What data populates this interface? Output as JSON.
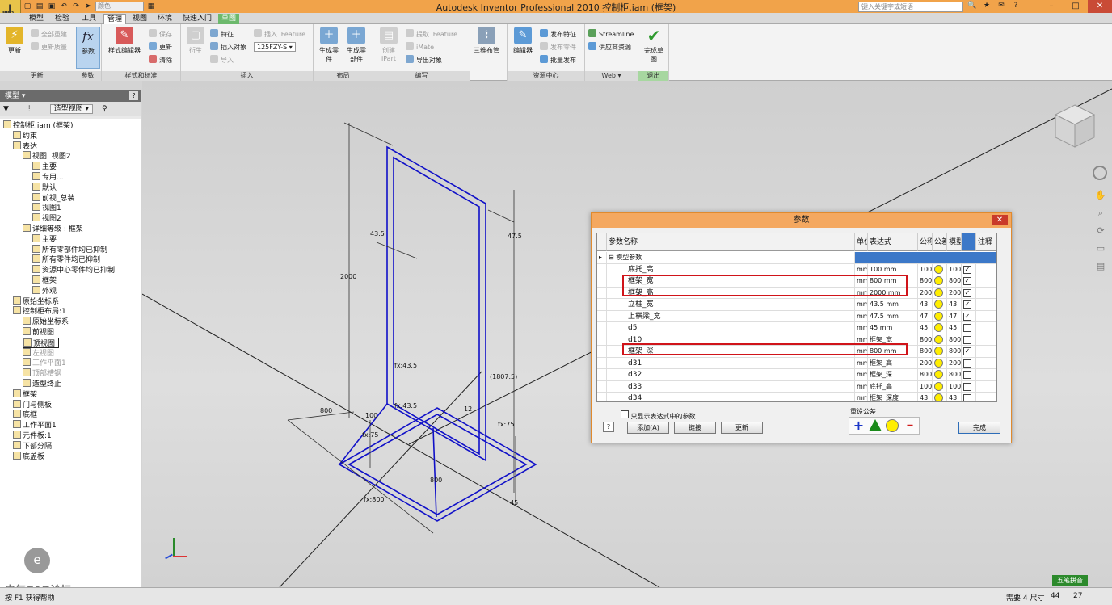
{
  "window": {
    "title": "Autodesk Inventor Professional 2010    控制柜.iam (框架)",
    "search_placeholder": "键入关键字或短语",
    "combo": "颜色",
    "logo_text": "I",
    "logo_sub": "PRO"
  },
  "tabs": [
    "模型",
    "检验",
    "工具",
    "管理",
    "视图",
    "环境",
    "快速入门",
    "草图",
    ""
  ],
  "active_tab": "管理",
  "ribbon": {
    "update": {
      "big": "更新",
      "items": [
        "全部重建",
        "更新质量"
      ],
      "group": "更新"
    },
    "params": {
      "big": "参数",
      "group": "参数"
    },
    "styles": {
      "big": "样式编辑器",
      "items": [
        "保存",
        "更新",
        "清除"
      ],
      "group": "样式和标准"
    },
    "insert": {
      "big": "衍生",
      "items": [
        "特征",
        "插入对象",
        "导入",
        "插入 iFeature"
      ],
      "combo": "125FZY-S",
      "group": "插入"
    },
    "layout": {
      "items": [
        "生成零件",
        "生成零部件"
      ],
      "group": "布局"
    },
    "author": {
      "big": "创建 iPart",
      "items": [
        "提取 iFeature",
        "iMate",
        "导出对象"
      ],
      "group": "编写"
    },
    "routing": {
      "big": "三维布管",
      "items": []
    },
    "content": {
      "big": "编辑器",
      "items": [
        "发布特征",
        "发布零件",
        "批量发布"
      ],
      "group": "资源中心"
    },
    "web": {
      "items": [
        "Streamline",
        "供应商资源"
      ],
      "group": "Web ▾"
    },
    "finish": {
      "big": "完成草图",
      "group": "退出"
    }
  },
  "browser": {
    "title": "模型 ▾",
    "view_combo": "造型视图",
    "nodes": [
      {
        "text": "控制柜.iam (框架)",
        "indent": 0
      },
      {
        "text": "约束",
        "indent": 1
      },
      {
        "text": "表达",
        "indent": 1
      },
      {
        "text": "视图: 视图2",
        "indent": 2
      },
      {
        "text": "主要",
        "indent": 3
      },
      {
        "text": "专用...",
        "indent": 3
      },
      {
        "text": "默认",
        "indent": 3
      },
      {
        "text": "前视_总装",
        "indent": 3
      },
      {
        "text": "视图1",
        "indent": 3
      },
      {
        "text": "视图2",
        "indent": 3
      },
      {
        "text": "详细等级 : 框架",
        "indent": 2
      },
      {
        "text": "主要",
        "indent": 3
      },
      {
        "text": "所有零部件均已抑制",
        "indent": 3
      },
      {
        "text": "所有零件均已抑制",
        "indent": 3
      },
      {
        "text": "资源中心零件均已抑制",
        "indent": 3
      },
      {
        "text": "框架",
        "indent": 3
      },
      {
        "text": "外观",
        "indent": 3
      },
      {
        "text": "原始坐标系",
        "indent": 1
      },
      {
        "text": "控制柜布局:1",
        "indent": 1
      },
      {
        "text": "原始坐标系",
        "indent": 2
      },
      {
        "text": "前视图",
        "indent": 2
      },
      {
        "text": "顶视图",
        "indent": 2,
        "selected": true
      },
      {
        "text": "左视图",
        "indent": 2,
        "gray": true
      },
      {
        "text": "工作平面1",
        "indent": 2,
        "gray": true
      },
      {
        "text": "顶部槽钢",
        "indent": 2,
        "gray": true
      },
      {
        "text": "造型终止",
        "indent": 2
      },
      {
        "text": "框架",
        "indent": 1
      },
      {
        "text": "门与侧板",
        "indent": 1
      },
      {
        "text": "底框",
        "indent": 1
      },
      {
        "text": "工作平面1",
        "indent": 1
      },
      {
        "text": "元件板:1",
        "indent": 1
      },
      {
        "text": "下部分隔",
        "indent": 1
      },
      {
        "text": "底盖板",
        "indent": 1
      }
    ]
  },
  "sketch": {
    "dims": [
      "43.5",
      "47.5",
      "2000",
      "(1807.5)",
      "fx:43.5",
      "fx:43.5",
      "800",
      "100",
      "12",
      "fx:75",
      "fx:75",
      "800",
      "fx:800",
      "45"
    ]
  },
  "dialog": {
    "title": "参数",
    "headers": [
      "参数名称",
      "单位",
      "表达式",
      "公称",
      "公差",
      "模型",
      "",
      "注释"
    ],
    "group_row": "模型参数",
    "rows": [
      {
        "name": "底托_高",
        "unit": "mm",
        "expr": "100 mm",
        "nom": "100",
        "model": "100",
        "checked": true
      },
      {
        "name": "框架_宽",
        "unit": "mm",
        "expr": "800 mm",
        "nom": "800",
        "model": "800",
        "checked": true
      },
      {
        "name": "框架_高",
        "unit": "mm",
        "expr": "2000 mm",
        "nom": "200",
        "model": "200",
        "checked": true
      },
      {
        "name": "立柱_宽",
        "unit": "mm",
        "expr": "43.5 mm",
        "nom": "43.",
        "model": "43.",
        "checked": true
      },
      {
        "name": "上横梁_宽",
        "unit": "mm",
        "expr": "47.5 mm",
        "nom": "47.",
        "model": "47.",
        "checked": true
      },
      {
        "name": "d5",
        "unit": "mm",
        "expr": "45 mm",
        "nom": "45.",
        "model": "45.",
        "checked": false
      },
      {
        "name": "d10",
        "unit": "mm",
        "expr": "框架_宽",
        "nom": "800",
        "model": "800",
        "checked": false
      },
      {
        "name": "框架_深",
        "unit": "mm",
        "expr": "800 mm",
        "nom": "800",
        "model": "800",
        "checked": true
      },
      {
        "name": "d31",
        "unit": "mm",
        "expr": "框架_高",
        "nom": "200",
        "model": "200",
        "checked": false
      },
      {
        "name": "d32",
        "unit": "mm",
        "expr": "框架_深",
        "nom": "800",
        "model": "800",
        "checked": false
      },
      {
        "name": "d33",
        "unit": "mm",
        "expr": "底托_高",
        "nom": "100",
        "model": "100",
        "checked": false
      },
      {
        "name": "d34",
        "unit": "mm",
        "expr": "框架_深度",
        "nom": "43.",
        "model": "43.",
        "checked": false
      }
    ],
    "filter_label": "只显示表达式中的参数",
    "reset_label": "重设公差",
    "help": "?",
    "buttons": {
      "add": "添加(A)",
      "link": "链接",
      "update": "更新",
      "done": "完成"
    }
  },
  "status": {
    "left": "按 F1 获得帮助",
    "right": "需要 4 尺寸",
    "n1": "44",
    "n2": "27",
    "badge": "五笔拼音"
  },
  "watermark": "电气CAD论坛",
  "colors": {
    "title": "#f1a34a",
    "dialog_title": "#f4a860",
    "sketch": "#1010c8",
    "highlight": "#d0141a"
  }
}
